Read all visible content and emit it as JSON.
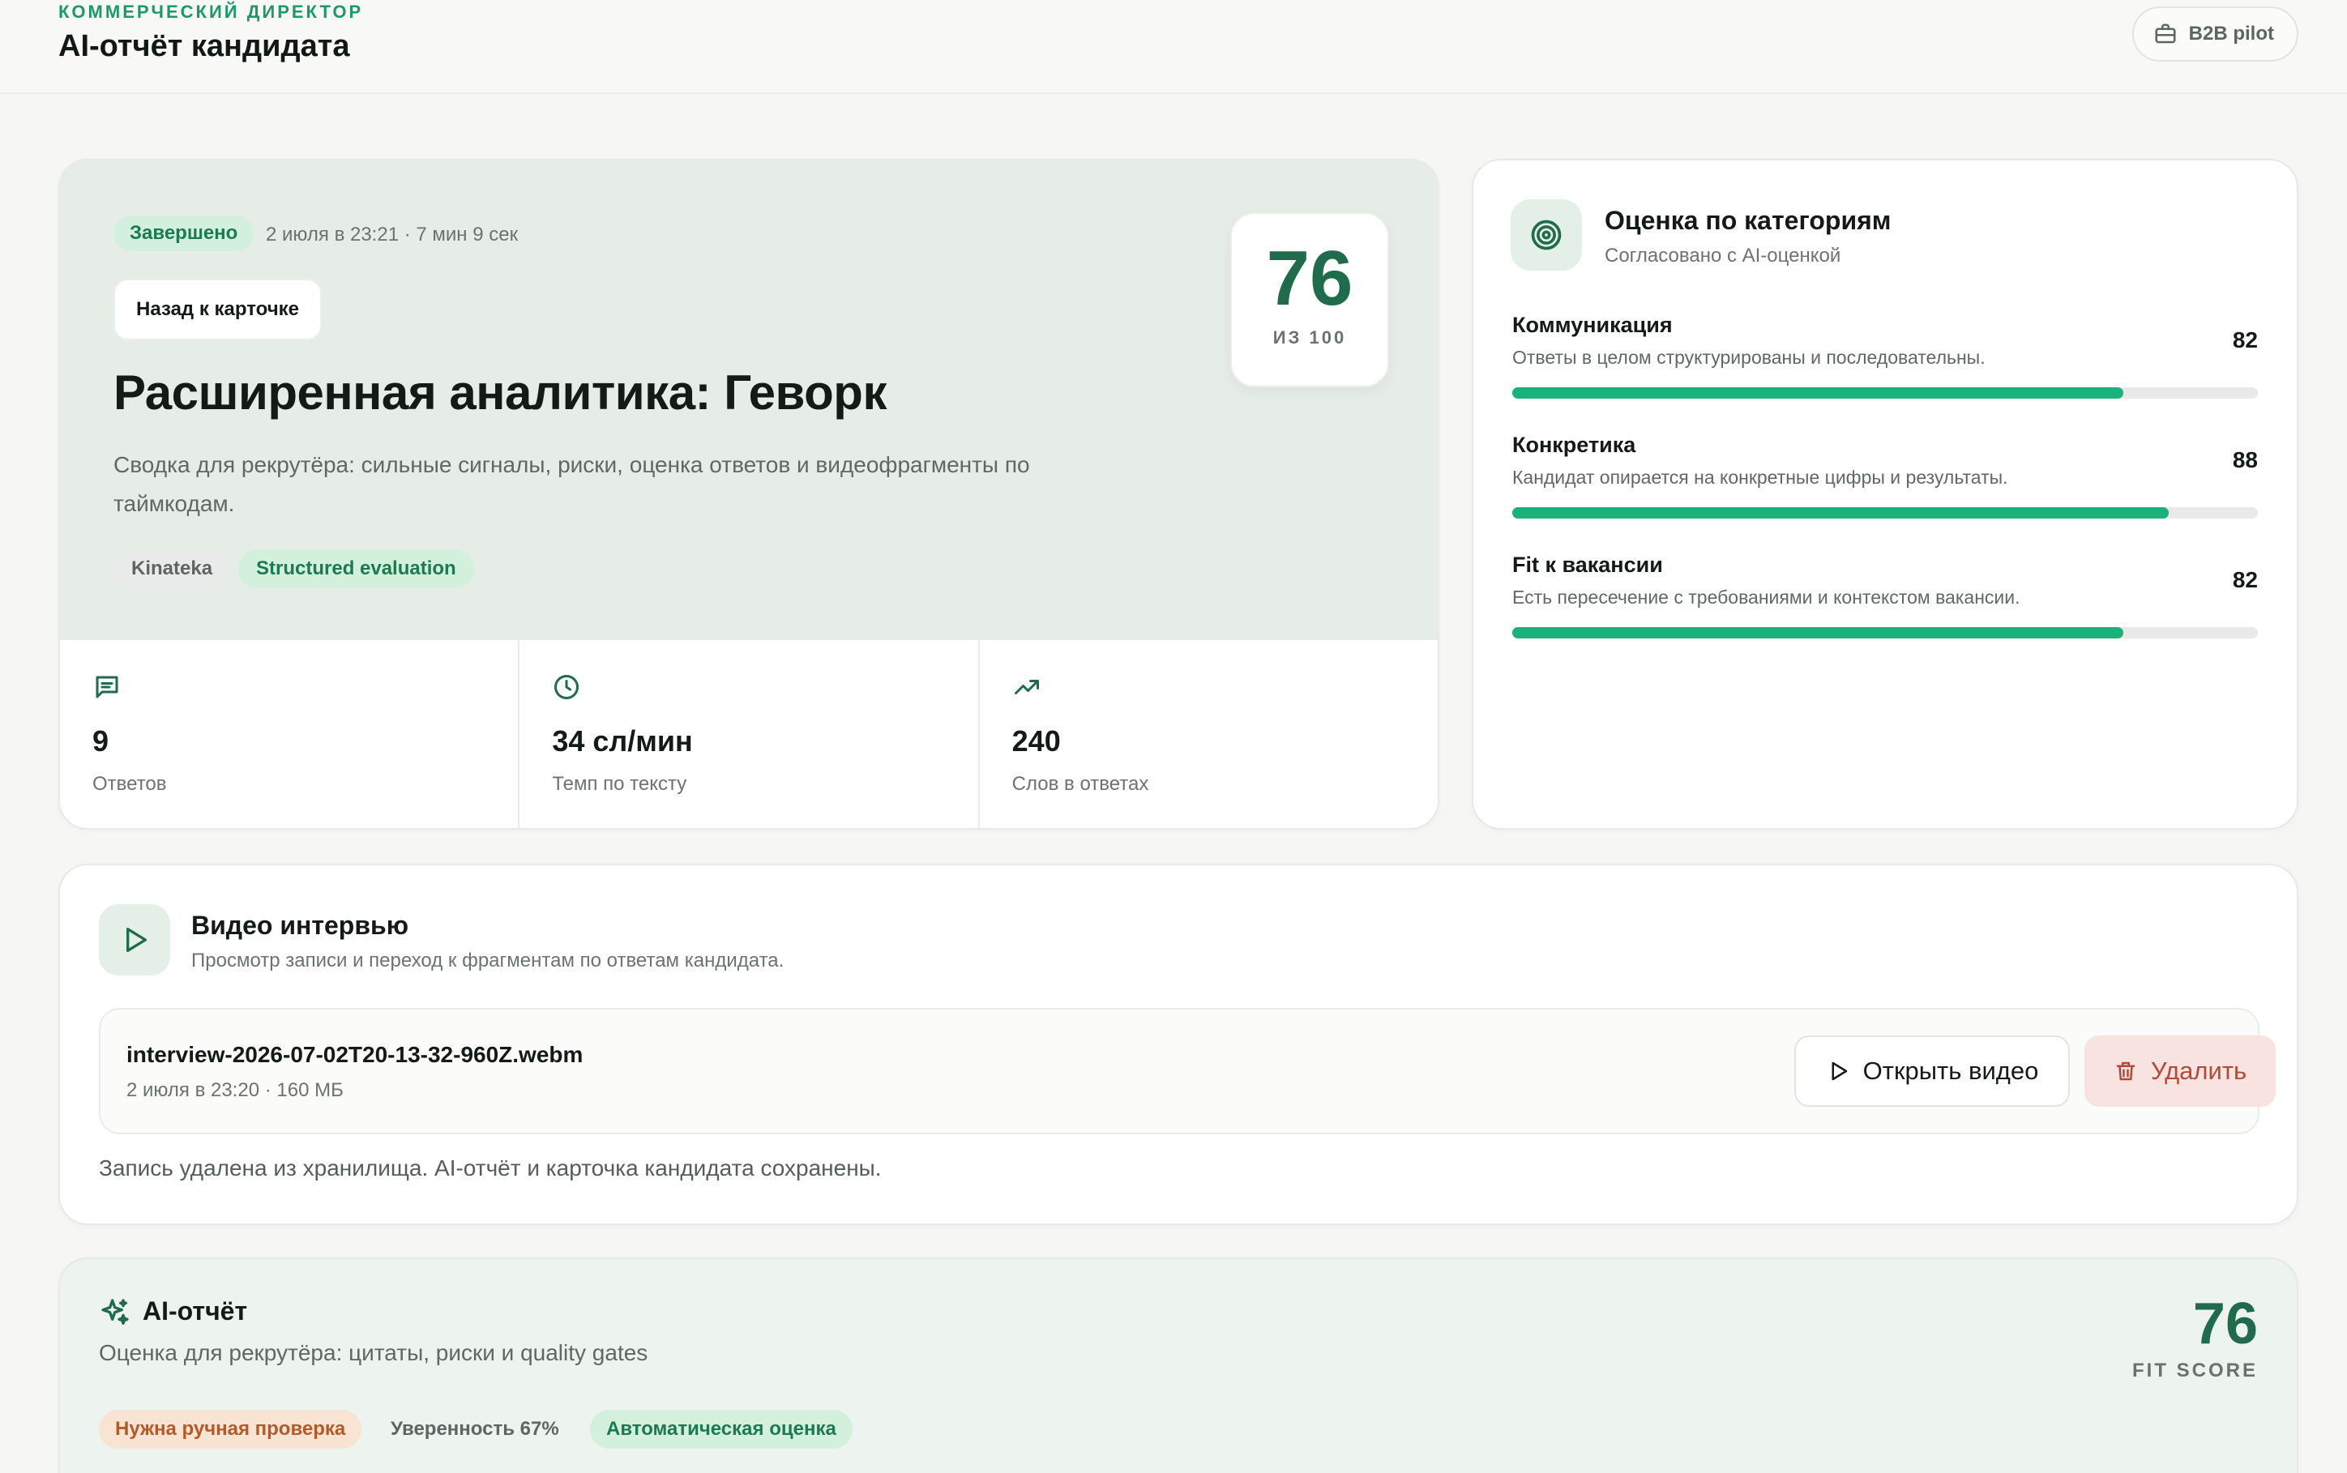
{
  "header": {
    "role": "КОММЕРЧЕСКИЙ ДИРЕКТОР",
    "title": "AI-отчёт кандидата",
    "pilot_label": "B2B pilot"
  },
  "hero": {
    "status": "Завершено",
    "meta": "2 июля в 23:21 · 7 мин 9 сек",
    "back_label": "Назад к карточке",
    "title": "Расширенная аналитика: Геворк",
    "description": "Сводка для рекрутёра: сильные сигналы, риски, оценка ответов и видеофрагменты по таймкодам.",
    "tags": [
      "Kinateka",
      "Structured evaluation"
    ],
    "score": "76",
    "score_of": "ИЗ 100",
    "stats": [
      {
        "icon": "chat-icon",
        "value": "9",
        "label": "Ответов"
      },
      {
        "icon": "clock-icon",
        "value": "34 сл/мин",
        "label": "Темп по тексту"
      },
      {
        "icon": "trend-up-icon",
        "value": "240",
        "label": "Слов в ответах"
      }
    ]
  },
  "categories": {
    "title": "Оценка по категориям",
    "subtitle": "Согласовано с AI-оценкой",
    "accent": "#19b27a",
    "items": [
      {
        "name": "Коммуникация",
        "desc": "Ответы в целом структурированы и последовательны.",
        "score": "82",
        "value": 82
      },
      {
        "name": "Конкретика",
        "desc": "Кандидат опирается на конкретные цифры и результаты.",
        "score": "88",
        "value": 88
      },
      {
        "name": "Fit к вакансии",
        "desc": "Есть пересечение с требованиями и контекстом вакансии.",
        "score": "82",
        "value": 82
      }
    ]
  },
  "video": {
    "title": "Видео интервью",
    "subtitle": "Просмотр записи и переход к фрагментам по ответам кандидата.",
    "file_name": "interview-2026-07-02T20-13-32-960Z.webm",
    "file_meta": "2 июля в 23:20 · 160 МБ",
    "open_label": "Открыть видео",
    "delete_label": "Удалить",
    "note": "Запись удалена из хранилища. AI-отчёт и карточка кандидата сохранены."
  },
  "ai_report": {
    "title": "AI-отчёт",
    "subtitle": "Оценка для рекрутёра: цитаты, риски и quality gates",
    "fit_score": "76",
    "fit_label": "FIT SCORE",
    "tags": [
      "Нужна ручная проверка",
      "Уверенность 67%",
      "Автоматическая оценка"
    ]
  }
}
